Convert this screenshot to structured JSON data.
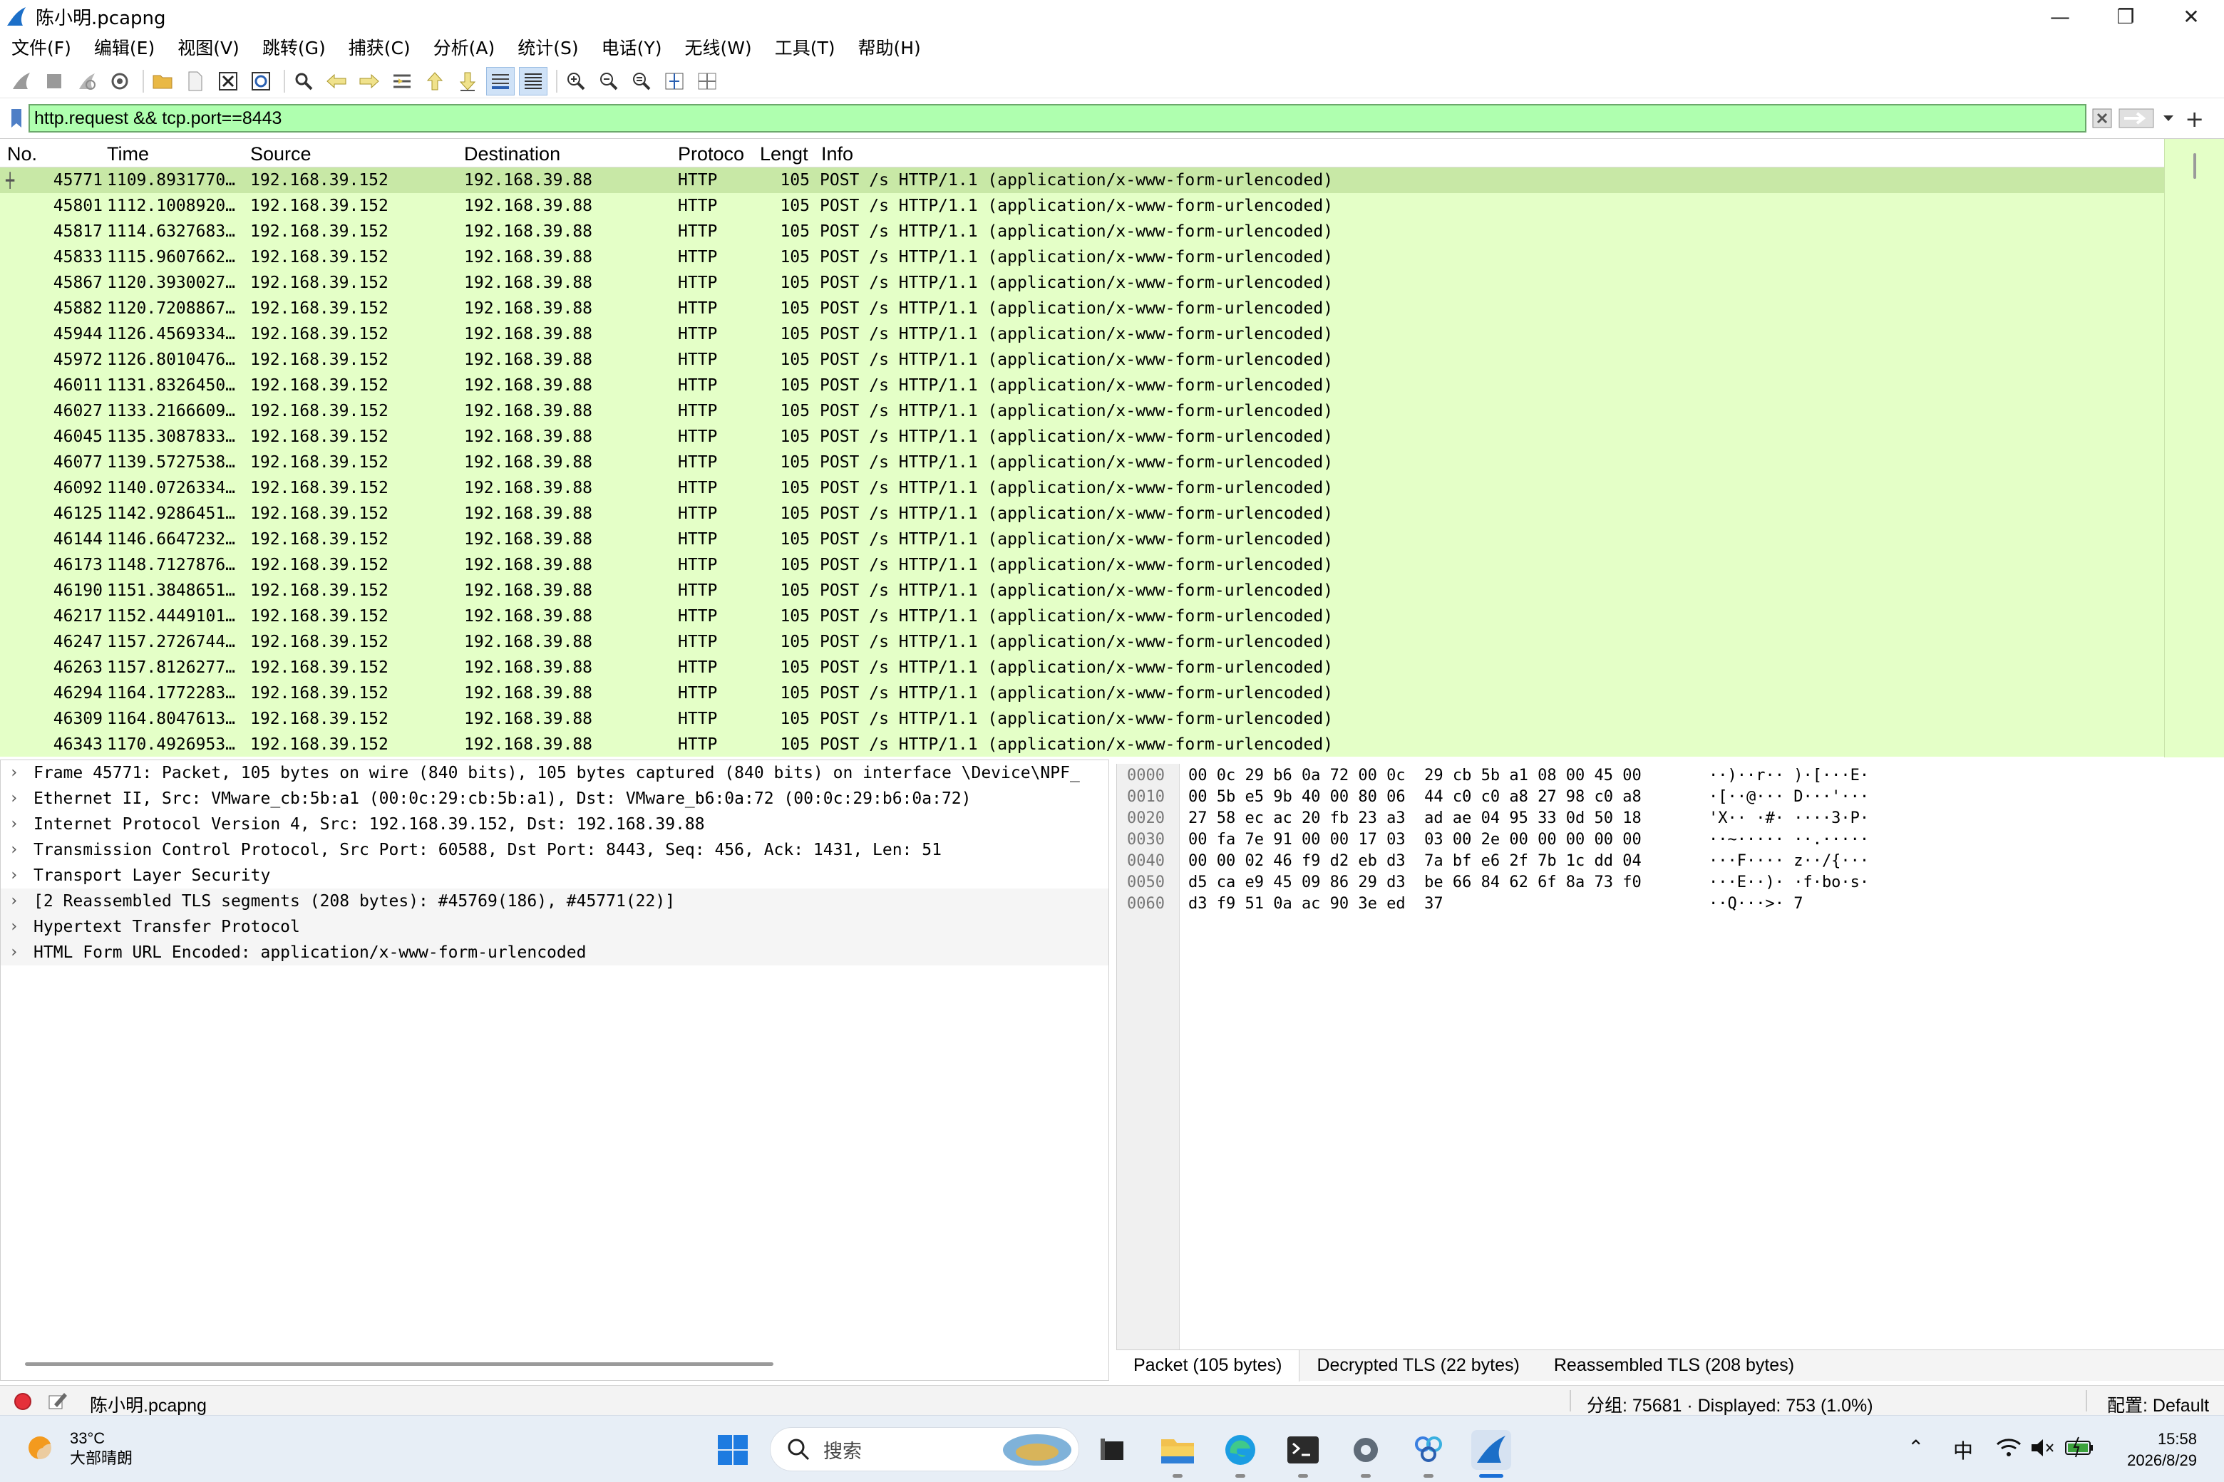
{
  "window": {
    "title": "陈小明.pcapng",
    "minimize": "—",
    "restore": "❐",
    "close": "✕"
  },
  "menu": [
    "文件(F)",
    "编辑(E)",
    "视图(V)",
    "跳转(G)",
    "捕获(C)",
    "分析(A)",
    "统计(S)",
    "电话(Y)",
    "无线(W)",
    "工具(T)",
    "帮助(H)"
  ],
  "toolbar_icons": [
    "shark-fin-start-icon",
    "stop-square-icon",
    "restart-icon",
    "gear-options-icon",
    "folder-open-icon",
    "file-icon",
    "close-file-icon",
    "reload-icon",
    "find-magnifier-icon",
    "back-arrow-icon",
    "forward-arrow-icon",
    "go-to-packet-icon",
    "first-packet-icon",
    "last-packet-icon",
    "autoscroll-icon",
    "colorize-icon",
    "zoom-in-icon",
    "zoom-out-icon",
    "zoom-normal-icon",
    "resize-columns-icon",
    "layout-icon"
  ],
  "filter": {
    "value": "http.request && tcp.port==8443",
    "add_label": "+"
  },
  "columns": {
    "no": "No.",
    "time": "Time",
    "source": "Source",
    "destination": "Destination",
    "protocol": "Protoco",
    "length": "Lengt",
    "info": "Info"
  },
  "packets": [
    {
      "no": "45771",
      "time": "1109.8931770…",
      "src": "192.168.39.152",
      "dst": "192.168.39.88",
      "proto": "HTTP",
      "len": "105",
      "info": "POST /s HTTP/1.1  (application/x-www-form-urlencoded)",
      "selected": true
    },
    {
      "no": "45801",
      "time": "1112.1008920…",
      "src": "192.168.39.152",
      "dst": "192.168.39.88",
      "proto": "HTTP",
      "len": "105",
      "info": "POST /s HTTP/1.1  (application/x-www-form-urlencoded)"
    },
    {
      "no": "45817",
      "time": "1114.6327683…",
      "src": "192.168.39.152",
      "dst": "192.168.39.88",
      "proto": "HTTP",
      "len": "105",
      "info": "POST /s HTTP/1.1  (application/x-www-form-urlencoded)"
    },
    {
      "no": "45833",
      "time": "1115.9607662…",
      "src": "192.168.39.152",
      "dst": "192.168.39.88",
      "proto": "HTTP",
      "len": "105",
      "info": "POST /s HTTP/1.1  (application/x-www-form-urlencoded)"
    },
    {
      "no": "45867",
      "time": "1120.3930027…",
      "src": "192.168.39.152",
      "dst": "192.168.39.88",
      "proto": "HTTP",
      "len": "105",
      "info": "POST /s HTTP/1.1  (application/x-www-form-urlencoded)"
    },
    {
      "no": "45882",
      "time": "1120.7208867…",
      "src": "192.168.39.152",
      "dst": "192.168.39.88",
      "proto": "HTTP",
      "len": "105",
      "info": "POST /s HTTP/1.1  (application/x-www-form-urlencoded)"
    },
    {
      "no": "45944",
      "time": "1126.4569334…",
      "src": "192.168.39.152",
      "dst": "192.168.39.88",
      "proto": "HTTP",
      "len": "105",
      "info": "POST /s HTTP/1.1  (application/x-www-form-urlencoded)"
    },
    {
      "no": "45972",
      "time": "1126.8010476…",
      "src": "192.168.39.152",
      "dst": "192.168.39.88",
      "proto": "HTTP",
      "len": "105",
      "info": "POST /s HTTP/1.1  (application/x-www-form-urlencoded)"
    },
    {
      "no": "46011",
      "time": "1131.8326450…",
      "src": "192.168.39.152",
      "dst": "192.168.39.88",
      "proto": "HTTP",
      "len": "105",
      "info": "POST /s HTTP/1.1  (application/x-www-form-urlencoded)"
    },
    {
      "no": "46027",
      "time": "1133.2166609…",
      "src": "192.168.39.152",
      "dst": "192.168.39.88",
      "proto": "HTTP",
      "len": "105",
      "info": "POST /s HTTP/1.1  (application/x-www-form-urlencoded)"
    },
    {
      "no": "46045",
      "time": "1135.3087833…",
      "src": "192.168.39.152",
      "dst": "192.168.39.88",
      "proto": "HTTP",
      "len": "105",
      "info": "POST /s HTTP/1.1  (application/x-www-form-urlencoded)"
    },
    {
      "no": "46077",
      "time": "1139.5727538…",
      "src": "192.168.39.152",
      "dst": "192.168.39.88",
      "proto": "HTTP",
      "len": "105",
      "info": "POST /s HTTP/1.1  (application/x-www-form-urlencoded)"
    },
    {
      "no": "46092",
      "time": "1140.0726334…",
      "src": "192.168.39.152",
      "dst": "192.168.39.88",
      "proto": "HTTP",
      "len": "105",
      "info": "POST /s HTTP/1.1  (application/x-www-form-urlencoded)"
    },
    {
      "no": "46125",
      "time": "1142.9286451…",
      "src": "192.168.39.152",
      "dst": "192.168.39.88",
      "proto": "HTTP",
      "len": "105",
      "info": "POST /s HTTP/1.1  (application/x-www-form-urlencoded)"
    },
    {
      "no": "46144",
      "time": "1146.6647232…",
      "src": "192.168.39.152",
      "dst": "192.168.39.88",
      "proto": "HTTP",
      "len": "105",
      "info": "POST /s HTTP/1.1  (application/x-www-form-urlencoded)"
    },
    {
      "no": "46173",
      "time": "1148.7127876…",
      "src": "192.168.39.152",
      "dst": "192.168.39.88",
      "proto": "HTTP",
      "len": "105",
      "info": "POST /s HTTP/1.1  (application/x-www-form-urlencoded)"
    },
    {
      "no": "46190",
      "time": "1151.3848651…",
      "src": "192.168.39.152",
      "dst": "192.168.39.88",
      "proto": "HTTP",
      "len": "105",
      "info": "POST /s HTTP/1.1  (application/x-www-form-urlencoded)"
    },
    {
      "no": "46217",
      "time": "1152.4449101…",
      "src": "192.168.39.152",
      "dst": "192.168.39.88",
      "proto": "HTTP",
      "len": "105",
      "info": "POST /s HTTP/1.1  (application/x-www-form-urlencoded)"
    },
    {
      "no": "46247",
      "time": "1157.2726744…",
      "src": "192.168.39.152",
      "dst": "192.168.39.88",
      "proto": "HTTP",
      "len": "105",
      "info": "POST /s HTTP/1.1  (application/x-www-form-urlencoded)"
    },
    {
      "no": "46263",
      "time": "1157.8126277…",
      "src": "192.168.39.152",
      "dst": "192.168.39.88",
      "proto": "HTTP",
      "len": "105",
      "info": "POST /s HTTP/1.1  (application/x-www-form-urlencoded)"
    },
    {
      "no": "46294",
      "time": "1164.1772283…",
      "src": "192.168.39.152",
      "dst": "192.168.39.88",
      "proto": "HTTP",
      "len": "105",
      "info": "POST /s HTTP/1.1  (application/x-www-form-urlencoded)"
    },
    {
      "no": "46309",
      "time": "1164.8047613…",
      "src": "192.168.39.152",
      "dst": "192.168.39.88",
      "proto": "HTTP",
      "len": "105",
      "info": "POST /s HTTP/1.1  (application/x-www-form-urlencoded)"
    },
    {
      "no": "46343",
      "time": "1170.4926953…",
      "src": "192.168.39.152",
      "dst": "192.168.39.88",
      "proto": "HTTP",
      "len": "105",
      "info": "POST /s HTTP/1.1  (application/x-www-form-urlencoded)"
    }
  ],
  "details": [
    "Frame 45771: Packet, 105 bytes on wire (840 bits), 105 bytes captured (840 bits) on interface \\Device\\NPF_",
    "Ethernet II, Src: VMware_cb:5b:a1 (00:0c:29:cb:5b:a1), Dst: VMware_b6:0a:72 (00:0c:29:b6:0a:72)",
    "Internet Protocol Version 4, Src: 192.168.39.152, Dst: 192.168.39.88",
    "Transmission Control Protocol, Src Port: 60588, Dst Port: 8443, Seq: 456, Ack: 1431, Len: 51",
    "Transport Layer Security",
    "[2 Reassembled TLS segments (208 bytes): #45769(186), #45771(22)]",
    "Hypertext Transfer Protocol",
    "HTML Form URL Encoded: application/x-www-form-urlencoded"
  ],
  "bytes": [
    {
      "offset": "0000",
      "hex": "00 0c 29 b6 0a 72 00 0c  29 cb 5b a1 08 00 45 00",
      "ascii": "··)··r·· )·[···E·"
    },
    {
      "offset": "0010",
      "hex": "00 5b e5 9b 40 00 80 06  44 c0 c0 a8 27 98 c0 a8",
      "ascii": "·[··@··· D···'···"
    },
    {
      "offset": "0020",
      "hex": "27 58 ec ac 20 fb 23 a3  ad ae 04 95 33 0d 50 18",
      "ascii": "'X·· ·#· ····3·P·"
    },
    {
      "offset": "0030",
      "hex": "00 fa 7e 91 00 00 17 03  03 00 2e 00 00 00 00 00",
      "ascii": "··~····· ··.·····"
    },
    {
      "offset": "0040",
      "hex": "00 00 02 46 f9 d2 eb d3  7a bf e6 2f 7b 1c dd 04",
      "ascii": "···F···· z··/{···"
    },
    {
      "offset": "0050",
      "hex": "d5 ca e9 45 09 86 29 d3  be 66 84 62 6f 8a 73 f0",
      "ascii": "···E··)· ·f·bo·s·"
    },
    {
      "offset": "0060",
      "hex": "d3 f9 51 0a ac 90 3e ed  37",
      "ascii": "··Q···>· 7"
    }
  ],
  "byte_tabs": [
    "Packet (105 bytes)",
    "Decrypted TLS (22 bytes)",
    "Reassembled TLS (208 bytes)"
  ],
  "status": {
    "file": "陈小明.pcapng",
    "counts": "分组: 75681 · Displayed: 753 (1.0%)",
    "profile": "配置: Default"
  },
  "taskbar": {
    "temperature": "33°C",
    "weather": "大部晴朗",
    "search_placeholder": "搜索",
    "ime": "中",
    "time": "15:58",
    "date": "2026/8/29"
  },
  "colors": {
    "filter_ok": "#afffaf",
    "http_row": "#e4ffc7",
    "selected_row": "#c8e8a6"
  }
}
